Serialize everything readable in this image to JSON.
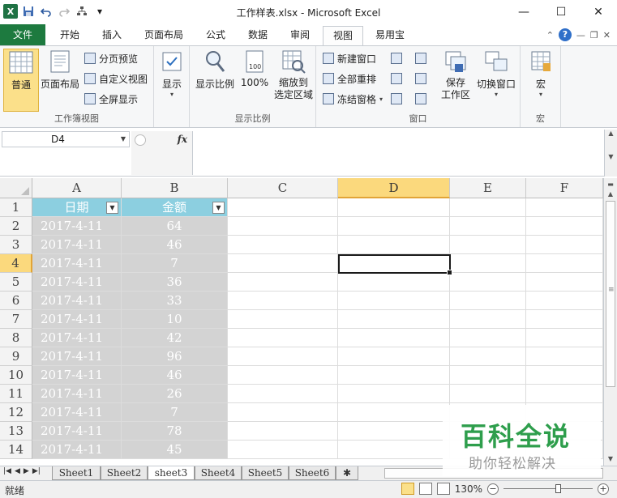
{
  "window": {
    "title": "工作样表.xlsx - Microsoft Excel",
    "minimize": "—",
    "maximize": "☐",
    "close": "✕"
  },
  "tabs": [
    {
      "label": "文件"
    },
    {
      "label": "开始"
    },
    {
      "label": "插入"
    },
    {
      "label": "页面布局"
    },
    {
      "label": "公式"
    },
    {
      "label": "数据"
    },
    {
      "label": "审阅"
    },
    {
      "label": "视图"
    },
    {
      "label": "易用宝"
    }
  ],
  "ribbon": {
    "groups": {
      "workbook_views": "工作簿视图",
      "zoom": "显示比例",
      "window": "窗口",
      "macros": "宏"
    },
    "normal": "普通",
    "page_layout": "页面布局",
    "page_break": "分页预览",
    "custom_views": "自定义视图",
    "full_screen": "全屏显示",
    "show": "显示",
    "zoom": "显示比例",
    "zoom100": "100%",
    "zoom_selection_1": "缩放到",
    "zoom_selection_2": "选定区域",
    "new_window": "新建窗口",
    "arrange_all": "全部重排",
    "freeze_panes": "冻结窗格",
    "save_workspace_1": "保存",
    "save_workspace_2": "工作区",
    "switch_windows": "切换窗口",
    "macros": "宏"
  },
  "formula_bar": {
    "name_box": "D4",
    "fx": "fx",
    "formula": ""
  },
  "grid": {
    "columns": [
      "A",
      "B",
      "C",
      "D",
      "E",
      "F"
    ],
    "selected_column": "D",
    "selected_row": "4",
    "header_row": {
      "row": "1",
      "date": "日期",
      "amount": "金额"
    },
    "rows": [
      {
        "row": "2",
        "date": "2017-4-11",
        "amount": "64"
      },
      {
        "row": "3",
        "date": "2017-4-11",
        "amount": "46"
      },
      {
        "row": "4",
        "date": "2017-4-11",
        "amount": "7"
      },
      {
        "row": "5",
        "date": "2017-4-11",
        "amount": "36"
      },
      {
        "row": "6",
        "date": "2017-4-11",
        "amount": "33"
      },
      {
        "row": "7",
        "date": "2017-4-11",
        "amount": "10"
      },
      {
        "row": "8",
        "date": "2017-4-11",
        "amount": "42"
      },
      {
        "row": "9",
        "date": "2017-4-11",
        "amount": "96"
      },
      {
        "row": "10",
        "date": "2017-4-11",
        "amount": "46"
      },
      {
        "row": "11",
        "date": "2017-4-11",
        "amount": "26"
      },
      {
        "row": "12",
        "date": "2017-4-11",
        "amount": "7"
      },
      {
        "row": "13",
        "date": "2017-4-11",
        "amount": "78"
      },
      {
        "row": "14",
        "date": "2017-4-11",
        "amount": "45"
      }
    ]
  },
  "sheets": [
    {
      "label": "Sheet1"
    },
    {
      "label": "Sheet2"
    },
    {
      "label": "sheet3",
      "active": true
    },
    {
      "label": "Sheet4"
    },
    {
      "label": "Sheet5"
    },
    {
      "label": "Sheet6"
    }
  ],
  "status": {
    "ready": "就绪",
    "zoom": "130%",
    "zoom_fraction": 0.62
  },
  "watermark": {
    "main": "百科全说",
    "sub": "助你轻松解决"
  },
  "colors": {
    "file_tab": "#1d7a3f",
    "header_fill": "#8ccfe0",
    "data_fill": "#d3d3d3",
    "selection": "#fbd97d",
    "watermark": "#2e9e4c"
  }
}
